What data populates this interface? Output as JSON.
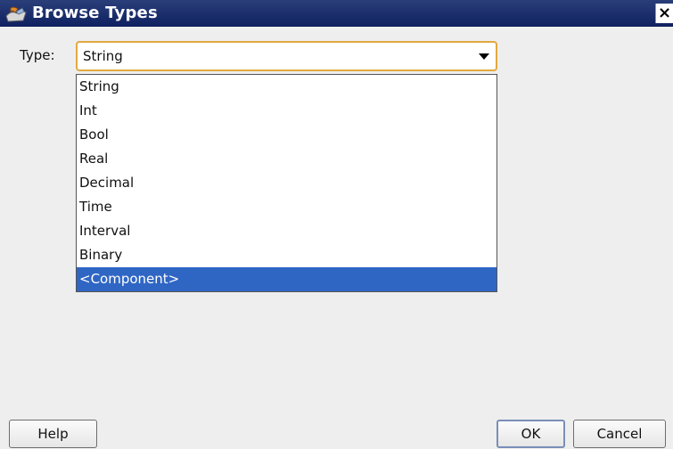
{
  "window": {
    "title": "Browse Types",
    "close_label": "×"
  },
  "type_field": {
    "label": "Type:",
    "selected_value": "String",
    "options": [
      "String",
      "Int",
      "Bool",
      "Real",
      "Decimal",
      "Time",
      "Interval",
      "Binary",
      "<Component>"
    ],
    "highlighted_index": 8
  },
  "buttons": {
    "help": "Help",
    "ok": "OK",
    "cancel": "Cancel"
  },
  "icons": {
    "title_icon": "browse-types-icon",
    "dropdown_arrow": "chevron-down-icon"
  },
  "colors": {
    "title_bar": "#0f2160",
    "selection": "#2f66c4",
    "focus_border": "#e2a93f"
  }
}
